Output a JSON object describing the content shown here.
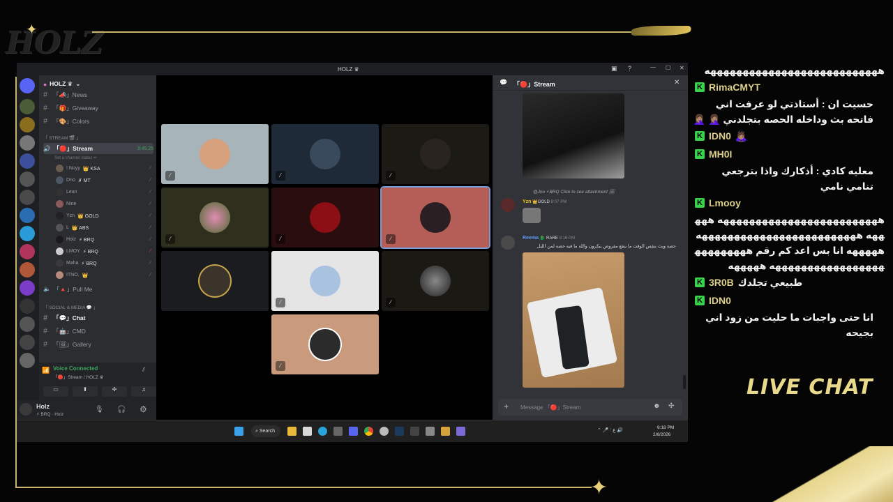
{
  "overlay": {
    "logo_text": "HOLZ",
    "live_chat_label": "LIVE CHAT"
  },
  "window": {
    "title": "HOLZ ♛",
    "server_name": "HOLZ ♛",
    "channels_top": [
      {
        "icon": "#",
        "label": "「📣」News"
      },
      {
        "icon": "#",
        "label": "「🎁」Giveaway"
      },
      {
        "icon": "#",
        "label": "「🎨」Colors"
      }
    ],
    "category_stream": "「 STREAM 🎬 」",
    "stream_channel": {
      "label": "「🔴」Stream",
      "timer": "3:45:25",
      "status": "Set a channel status ✏"
    },
    "voice_users": [
      {
        "name": "! Noyy",
        "tag": "👑 KSA"
      },
      {
        "name": "Dno",
        "tag": "✗ MT"
      },
      {
        "name": "Lean",
        "tag": ""
      },
      {
        "name": "Nine",
        "tag": ""
      },
      {
        "name": "Yzn",
        "tag": "👑 GOLD"
      },
      {
        "name": "L",
        "tag": "👑 ABS"
      },
      {
        "name": "Holz",
        "tag": "⚡ BRQ"
      },
      {
        "name": "LMOY",
        "tag": "⚡ BRQ"
      },
      {
        "name": "Maha",
        "tag": "⚡ BRQ"
      },
      {
        "name": "ITNO.",
        "tag": "👑"
      }
    ],
    "pull_me": "「🔺」Pull Me",
    "category_social": "「 SOCIAL & MEDIA 💬 」",
    "channels_bottom": [
      {
        "icon": "#",
        "label": "「💬」Chat"
      },
      {
        "icon": "#",
        "label": "「🤖」CMD"
      },
      {
        "icon": "#",
        "label": "「🖼」Gallery"
      }
    ],
    "voice_connected": "Voice Connected",
    "voice_location": "「🔴」Stream / HOLZ ♛",
    "user_name": "Holz",
    "user_status": "⚡ BRQ · Holz",
    "chat_header": "「🔴」Stream",
    "messages": [
      {
        "reply": "@Jno ⚡BRQ Click to see attachment 🖼",
        "author": "Yzn",
        "badge": "👑GOLD",
        "time": "8:07 PM",
        "text": ""
      },
      {
        "author": "Reema",
        "badge": "🐉 RARE",
        "time": "8:16 PM",
        "text": "حصه وبث بنفس الوقت ما ينفع مفروض يبكرون والله ما فيه حصه لمن الليل"
      }
    ],
    "message_placeholder": "Message 「🔴」Stream",
    "taskbar": {
      "search": "Search",
      "time": "8:18 PM",
      "date": "2/8/2026"
    }
  },
  "live_chat": [
    {
      "name": "",
      "text": "هههههههههههههههههههههههههههه"
    },
    {
      "name": "RimaCMYT",
      "text": "حسيت ان : أستاذتي لو عرفت اني فاتحه بث وداخله الحصه بتجلدني 🤦🏽‍♀️ 🤦🏽‍♀️"
    },
    {
      "name": "IDN0",
      "text": "🙇🏽‍♀️"
    },
    {
      "name": "MH0I",
      "text": "معليه كادي : أذكارك واذا بترجعي تنامي نامي"
    },
    {
      "name": "Lmooy",
      "text": "هههههههههههههههههههههههههه هههههه هههههههههههههههههههههههههه هههههه انا بس اعد كم رقم ههههههههههههههههههههههههههه هههههه"
    },
    {
      "name": "3R0B",
      "text": "طبيعي تجلدك"
    },
    {
      "name": "IDN0",
      "text": "انا حتى واجبات ما حليت من زود اني بجيحه"
    }
  ]
}
